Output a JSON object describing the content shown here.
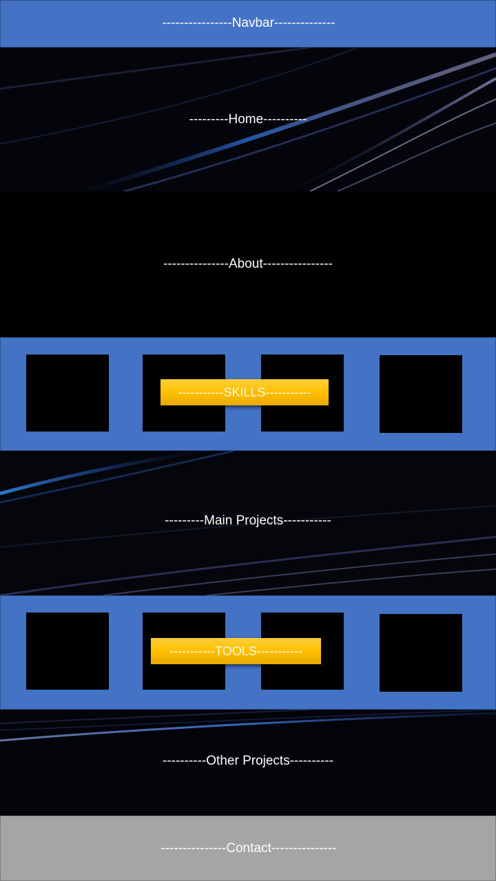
{
  "sections": {
    "navbar": "----------------Navbar--------------",
    "home": "---------Home----------",
    "about": "---------------About----------------",
    "skills": "-----------SKILLS-----------",
    "main_projects": "---------Main Projects-----------",
    "tools": "-----------TOOLS-----------",
    "other_projects": "----------Other Projects----------",
    "contact": "---------------Contact---------------"
  },
  "colors": {
    "band_blue": "#4472c4",
    "badge_gold": "#ffc000",
    "contact_gray": "#a5a5a5",
    "dark_background": "#000000"
  }
}
